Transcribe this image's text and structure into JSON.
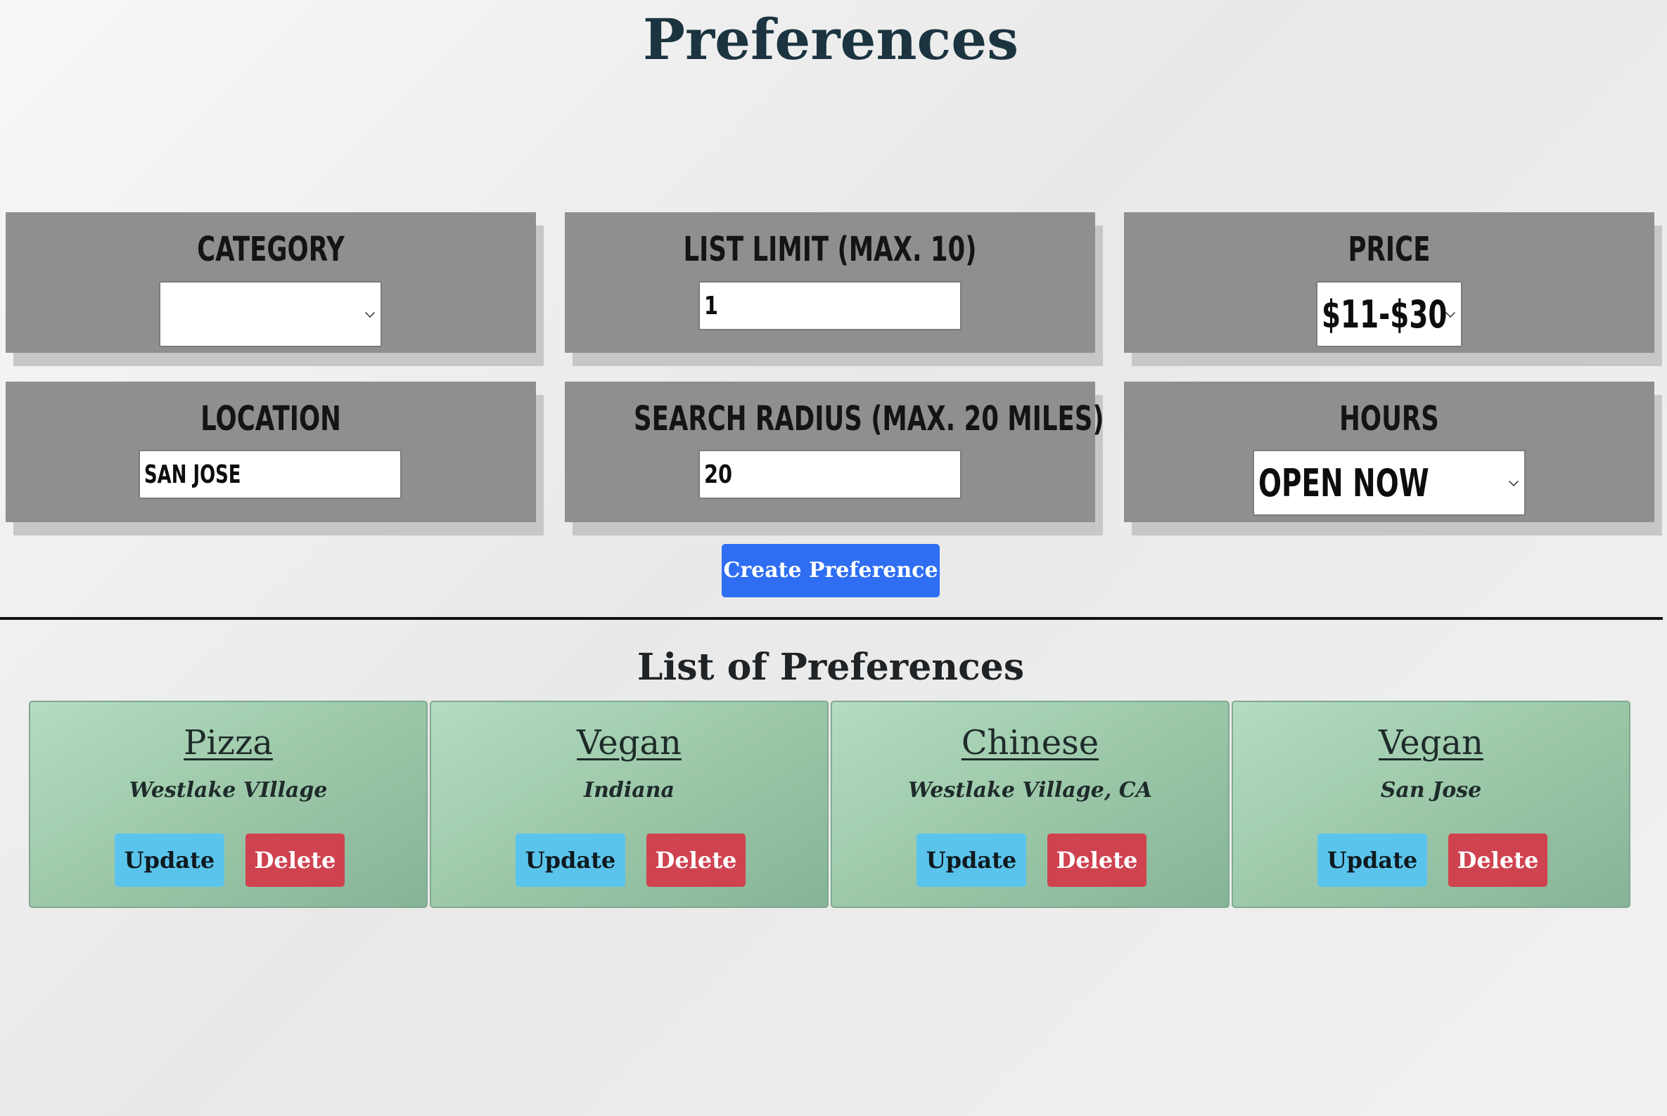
{
  "page": {
    "title": "Preferences"
  },
  "form": {
    "category": {
      "label": "Category",
      "value": ""
    },
    "list_limit": {
      "label": "List Limit (max. 10)",
      "value": "1"
    },
    "price": {
      "label": "Price",
      "value": "$11-$30"
    },
    "location": {
      "label": "Location",
      "value": "San Jose"
    },
    "search_radius": {
      "label": "Search Radius (max. 20 miles)",
      "value": "20"
    },
    "hours": {
      "label": "Hours",
      "value": "Open Now"
    },
    "create_button": "Create Preference"
  },
  "list": {
    "title": "List of Preferences",
    "update_label": "Update",
    "delete_label": "Delete",
    "cards": [
      {
        "category": "Pizza",
        "location": "Westlake VIllage"
      },
      {
        "category": "Vegan",
        "location": "Indiana"
      },
      {
        "category": "Chinese",
        "location": "Westlake Village, CA"
      },
      {
        "category": "Vegan",
        "location": "San Jose"
      }
    ]
  },
  "colors": {
    "panel": "#8f8f8f",
    "primary": "#2f6ef2",
    "info": "#5bc4ec",
    "danger": "#cf4350",
    "card": "#9cc8a9"
  }
}
